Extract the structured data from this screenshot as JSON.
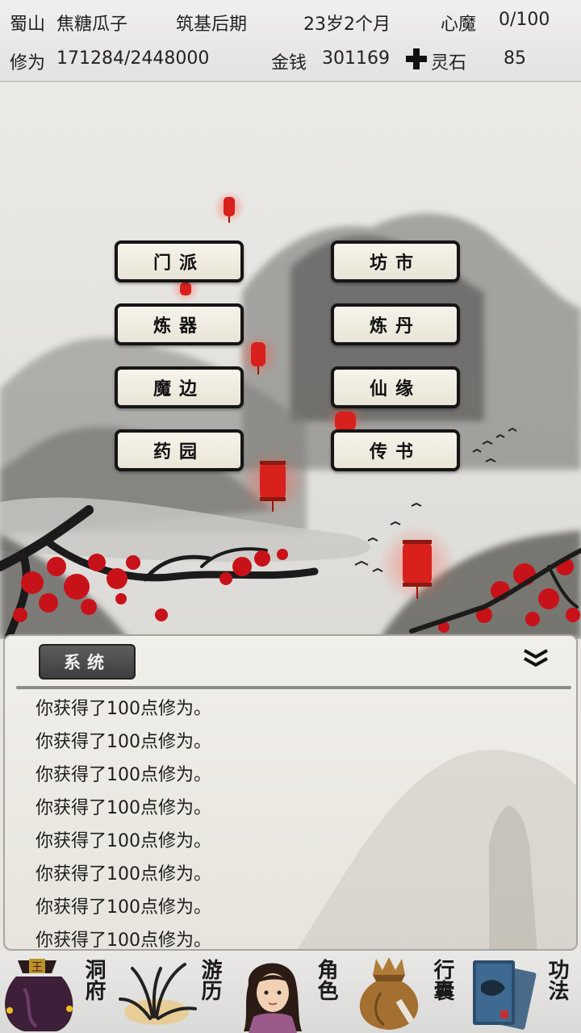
{
  "status": {
    "sect": "蜀山",
    "name": "焦糖瓜子",
    "realm": "筑基后期",
    "age": "23岁2个月",
    "heart_demon_label": "心魔",
    "heart_demon_value": "0/100",
    "cultivation_label": "修为",
    "cultivation_value": "171284/2448000",
    "money_label": "金钱",
    "money_value": "301169",
    "spirit_stone_icon": "cross-icon",
    "spirit_stone_label": "灵石",
    "spirit_stone_value": "85"
  },
  "menu": {
    "sect": "门派",
    "market": "坊市",
    "refining": "炼器",
    "alchemy": "炼丹",
    "demon_border": "魔边",
    "immortal_fate": "仙缘",
    "herb_garden": "药园",
    "letters": "传书"
  },
  "log": {
    "tab_label": "系统",
    "lines": [
      "你获得了100点修为。",
      "你获得了100点修为。",
      "你获得了100点修为。",
      "你获得了100点修为。",
      "你获得了100点修为。",
      "你获得了100点修为。",
      "你获得了100点修为。",
      "你获得了100点修为。"
    ]
  },
  "nav": {
    "cave": "洞府",
    "travel": "游历",
    "character": "角色",
    "bag": "行囊",
    "techniques": "功法",
    "cave_icon_mark": "王"
  },
  "colors": {
    "lantern": "#d8201c",
    "blossom": "#c8121a",
    "button_border": "#151515",
    "button_bg": "#f3efe4"
  }
}
